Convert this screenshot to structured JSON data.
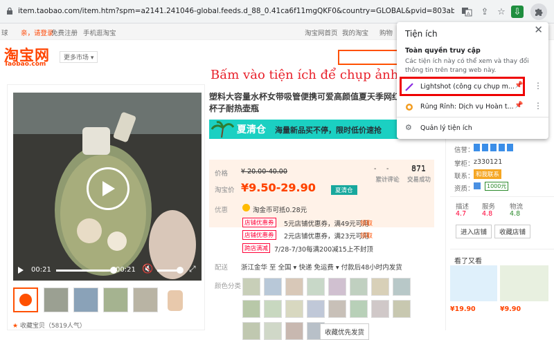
{
  "browser": {
    "url": "item.taobao.com/item.htm?spm=a2141.241046-global.feeds.d_88_0.41ca6f11mgQKF0&country=GLOBAL&pvid=803abe1e-0fb0-412a-970e-2f6adec..."
  },
  "taobao": {
    "topbar": {
      "region": "球",
      "login": "亲，请登录",
      "register": "免费注册",
      "mobile": "手机逛淘宝",
      "home": "淘宝网首页",
      "my_taobao": "我的淘宝",
      "cart": "购物"
    },
    "logo_cn": "淘宝网",
    "logo_en": "Taobao.com",
    "more_market": "更多市场",
    "overlay_caption": "Bấm vào tiện ích để chụp ảnh",
    "product": {
      "title": "塑料大容量水杯女带吸管便携可爱高颜值夏天季网红杯子耐热壶瓶",
      "banner_title": "夏清仓",
      "banner_text": "海量新品买不停，限时低价速抢",
      "price_label": "价格",
      "price_original": "¥ 20.00-40.00",
      "taobao_price_label": "淘宝价",
      "price_current": "¥9.50-29.90",
      "clearance_tag": "夏清仓",
      "reviews_value": "-",
      "reviews_label": "累计评论",
      "sold_value": "871",
      "sold_label": "交易成功",
      "promo_label": "优惠",
      "coin_text": "淘金币可抵0.28元",
      "coupon_tag": "店铺优惠券",
      "coupon1": "5元店铺优惠券，满49元可用",
      "coupon2": "2元店铺优惠券，满23元可用",
      "get": "领取",
      "full_reduction_tag": "跨店满减",
      "full_reduction": "7/28-7/30每满200减15上不封顶",
      "shipping_label": "配送",
      "shipping": "浙江金华 至 全国 ▾ 快递 免运费 ▾ 付款后48小时内发货",
      "color_label": "颜色分类",
      "favorite_first": "收藏优先发货",
      "favorite_count": "收藏宝贝（5819人气）"
    },
    "video": {
      "time_current": "00:21",
      "time_total": "00:21"
    },
    "seller": {
      "credit_label": "信誉：",
      "shopkeeper_label": "掌柜：",
      "shopkeeper": "z330121",
      "contact_label": "联系：",
      "contact": "和我联系",
      "quality_label": "资质：",
      "deposit": "1000元",
      "scores": [
        {
          "label": "描述",
          "value": "4.7"
        },
        {
          "label": "服务",
          "value": "4.8"
        },
        {
          "label": "物流",
          "value": "4.8"
        }
      ],
      "enter_shop": "进入店铺",
      "fav_shop": "收藏店铺"
    },
    "side": {
      "heading": "看了又看",
      "prices": [
        "¥19.90",
        "¥9.90"
      ]
    }
  },
  "extensions_menu": {
    "title": "Tiện ích",
    "subtitle": "Toàn quyền truy cập",
    "description": "Các tiện ích này có thể xem và thay đổi thông tin trên trang web này.",
    "items": [
      {
        "name": "Lightshot (công cụ chụp m..."
      },
      {
        "name": "Rủng Rỉnh: Dịch vụ Hoàn t..."
      }
    ],
    "manage": "Quản lý tiện ích"
  }
}
